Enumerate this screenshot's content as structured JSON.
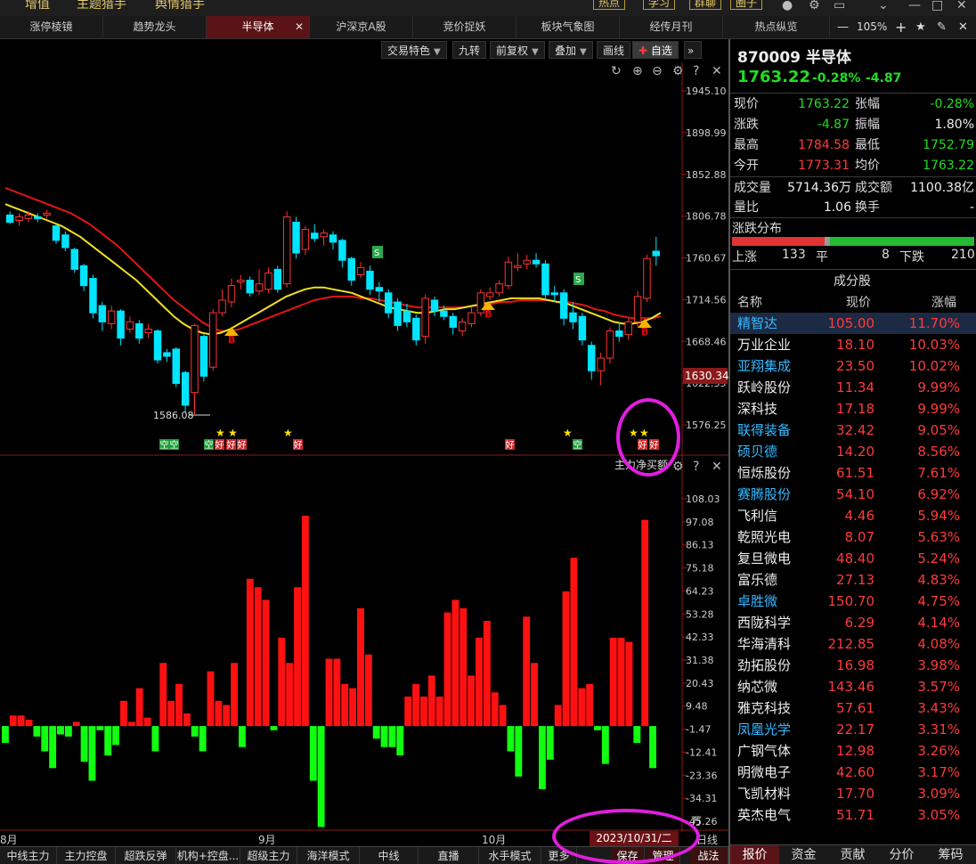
{
  "top_nav": {
    "items": [
      "增值",
      "主题猎手",
      "舆情猎手"
    ],
    "tools": [
      "热点",
      "学习",
      "群聊",
      "圈子"
    ]
  },
  "tabs": [
    "涨停棱镜",
    "趋势龙头",
    "半导体",
    "沪深京A股",
    "竞价捉妖",
    "板块气象图",
    "经传月刊",
    "热点纵览"
  ],
  "active_tab": "半导体",
  "zoom": "105%",
  "chart_toolbar": {
    "buttons": [
      "交易特色",
      "九转",
      "前复权",
      "叠加",
      "画线"
    ],
    "add_fav": "自选"
  },
  "chart": {
    "price_ticks": [
      "1945.10",
      "1898.99",
      "1852.88",
      "1806.78",
      "1760.67",
      "1714.56",
      "1668.46",
      "1622.35",
      "1576.25"
    ],
    "current_price_label": "1630.34",
    "low_label": "1586.08",
    "indicator_name": "主力净买额",
    "indicator_ticks": [
      "108.03",
      "97.08",
      "86.13",
      "75.18",
      "64.23",
      "53.28",
      "42.33",
      "31.38",
      "20.43",
      "9.48",
      "-1.47",
      "-12.41",
      "-23.36",
      "-34.31",
      "-45.26"
    ],
    "indicator_unit": "万",
    "months": [
      "8月",
      "9月",
      "10月"
    ],
    "date_cursor": "2023/10/31/二",
    "period_label": "日线",
    "signal_labels": {
      "kong": "空",
      "hao": "好",
      "buy": "B",
      "sell": "S"
    }
  },
  "bottom_tabs": [
    "中线主力",
    "主力控盘",
    "超跌反弹",
    "机构+控盘...",
    "超级主力",
    "海洋模式",
    "中线",
    "直播",
    "水手模式",
    "更多",
    "保存",
    "管理",
    "战法"
  ],
  "quote": {
    "code_name": "870009 半导体",
    "price": "1763.22",
    "pct": "-0.28%",
    "change": "-4.87",
    "rows": [
      {
        "l1": "现价",
        "v1": "1763.22",
        "c1": "green",
        "l2": "张幅",
        "v2": "-0.28%",
        "c2": "green"
      },
      {
        "l1": "涨跌",
        "v1": "-4.87",
        "c1": "green",
        "l2": "振幅",
        "v2": "1.80%",
        "c2": "white"
      },
      {
        "l1": "最高",
        "v1": "1784.58",
        "c1": "red",
        "l2": "最低",
        "v2": "1752.79",
        "c2": "green"
      },
      {
        "l1": "今开",
        "v1": "1773.31",
        "c1": "red",
        "l2": "均价",
        "v2": "1763.22",
        "c2": "green"
      }
    ],
    "rows2": [
      {
        "l1": "成交量",
        "v1": "5714.36万",
        "l2": "成交额",
        "v2": "1100.38亿"
      },
      {
        "l1": "量比",
        "v1": "1.06",
        "l2": "换手",
        "v2": "-"
      }
    ]
  },
  "distribution": {
    "title": "涨跌分布",
    "up_label": "上涨",
    "up": "133",
    "flat_label": "平",
    "flat": "8",
    "down_label": "下跌",
    "down": "210"
  },
  "components": {
    "title": "成分股",
    "headers": [
      "名称",
      "现价",
      "涨幅"
    ],
    "rows": [
      {
        "name": "精智达",
        "price": "105.00",
        "pct": "11.70%",
        "color": "cyan"
      },
      {
        "name": "万业企业",
        "price": "18.10",
        "pct": "10.03%",
        "color": "yel"
      },
      {
        "name": "亚翔集成",
        "price": "23.50",
        "pct": "10.02%",
        "color": "cyan"
      },
      {
        "name": "跃岭股份",
        "price": "11.34",
        "pct": "9.99%",
        "color": "yel"
      },
      {
        "name": "深科技",
        "price": "17.18",
        "pct": "9.99%",
        "color": "yel"
      },
      {
        "name": "联得装备",
        "price": "32.42",
        "pct": "9.05%",
        "color": "cyan"
      },
      {
        "name": "硕贝德",
        "price": "14.20",
        "pct": "8.56%",
        "color": "cyan"
      },
      {
        "name": "恒烁股份",
        "price": "61.51",
        "pct": "7.61%",
        "color": "yel"
      },
      {
        "name": "赛腾股份",
        "price": "54.10",
        "pct": "6.92%",
        "color": "cyan"
      },
      {
        "name": "飞利信",
        "price": "4.46",
        "pct": "5.94%",
        "color": "yel"
      },
      {
        "name": "乾照光电",
        "price": "8.07",
        "pct": "5.63%",
        "color": "yel"
      },
      {
        "name": "复旦微电",
        "price": "48.40",
        "pct": "5.24%",
        "color": "yel"
      },
      {
        "name": "富乐德",
        "price": "27.13",
        "pct": "4.83%",
        "color": "yel"
      },
      {
        "name": "卓胜微",
        "price": "150.70",
        "pct": "4.75%",
        "color": "cyan"
      },
      {
        "name": "西陇科学",
        "price": "6.29",
        "pct": "4.14%",
        "color": "yel"
      },
      {
        "name": "华海清科",
        "price": "212.85",
        "pct": "4.08%",
        "color": "yel"
      },
      {
        "name": "劲拓股份",
        "price": "16.98",
        "pct": "3.98%",
        "color": "yel"
      },
      {
        "name": "纳芯微",
        "price": "143.46",
        "pct": "3.57%",
        "color": "yel"
      },
      {
        "name": "雅克科技",
        "price": "57.61",
        "pct": "3.43%",
        "color": "yel"
      },
      {
        "name": "凤凰光学",
        "price": "22.17",
        "pct": "3.31%",
        "color": "cyan"
      },
      {
        "name": "广钢气体",
        "price": "12.98",
        "pct": "3.26%",
        "color": "yel"
      },
      {
        "name": "明微电子",
        "price": "42.60",
        "pct": "3.17%",
        "color": "yel"
      },
      {
        "name": "飞凯材料",
        "price": "17.70",
        "pct": "3.09%",
        "color": "yel"
      },
      {
        "name": "英杰电气",
        "price": "51.71",
        "pct": "3.05%",
        "color": "yel"
      }
    ]
  },
  "right_tabs": [
    "报价",
    "资金",
    "贡献",
    "分价",
    "筹码"
  ],
  "right_tab_active": "报价",
  "chart_data": {
    "type": "candlestick",
    "title": "",
    "price_axis": [
      1576.25,
      1945.1
    ],
    "candles": [
      [
        1808,
        1800,
        1812,
        1798
      ],
      [
        1802,
        1806,
        1810,
        1796
      ],
      [
        1804,
        1808,
        1812,
        1800
      ],
      [
        1806,
        1804,
        1810,
        1800
      ],
      [
        1808,
        1810,
        1814,
        1804
      ],
      [
        1796,
        1780,
        1798,
        1776
      ],
      [
        1786,
        1772,
        1790,
        1768
      ],
      [
        1770,
        1748,
        1772,
        1744
      ],
      [
        1752,
        1730,
        1754,
        1724
      ],
      [
        1738,
        1700,
        1742,
        1694
      ],
      [
        1708,
        1690,
        1712,
        1680
      ],
      [
        1688,
        1702,
        1708,
        1682
      ],
      [
        1702,
        1672,
        1704,
        1664
      ],
      [
        1682,
        1690,
        1696,
        1678
      ],
      [
        1688,
        1672,
        1692,
        1666
      ],
      [
        1678,
        1682,
        1688,
        1672
      ],
      [
        1680,
        1648,
        1682,
        1644
      ],
      [
        1656,
        1652,
        1660,
        1646
      ],
      [
        1660,
        1622,
        1662,
        1618
      ],
      [
        1634,
        1598,
        1636,
        1590
      ],
      [
        1612,
        1686,
        1688,
        1588
      ],
      [
        1674,
        1630,
        1676,
        1624
      ],
      [
        1640,
        1700,
        1704,
        1636
      ],
      [
        1700,
        1714,
        1726,
        1696
      ],
      [
        1712,
        1730,
        1738,
        1706
      ],
      [
        1734,
        1736,
        1742,
        1726
      ],
      [
        1736,
        1722,
        1740,
        1718
      ],
      [
        1724,
        1732,
        1748,
        1720
      ],
      [
        1726,
        1744,
        1750,
        1722
      ],
      [
        1748,
        1726,
        1752,
        1722
      ],
      [
        1732,
        1806,
        1812,
        1728
      ],
      [
        1800,
        1766,
        1806,
        1760
      ],
      [
        1770,
        1792,
        1796,
        1764
      ],
      [
        1788,
        1782,
        1798,
        1778
      ],
      [
        1784,
        1788,
        1792,
        1774
      ],
      [
        1786,
        1778,
        1790,
        1770
      ],
      [
        1780,
        1758,
        1782,
        1750
      ],
      [
        1760,
        1736,
        1762,
        1730
      ],
      [
        1742,
        1750,
        1756,
        1738
      ],
      [
        1746,
        1726,
        1752,
        1720
      ],
      [
        1728,
        1724,
        1734,
        1712
      ],
      [
        1722,
        1700,
        1726,
        1694
      ],
      [
        1712,
        1686,
        1716,
        1680
      ],
      [
        1702,
        1690,
        1710,
        1684
      ],
      [
        1694,
        1670,
        1698,
        1664
      ],
      [
        1674,
        1716,
        1720,
        1666
      ],
      [
        1714,
        1702,
        1718,
        1696
      ],
      [
        1702,
        1696,
        1708,
        1692
      ],
      [
        1696,
        1684,
        1700,
        1676
      ],
      [
        1680,
        1690,
        1694,
        1674
      ],
      [
        1688,
        1700,
        1706,
        1684
      ],
      [
        1700,
        1722,
        1726,
        1696
      ],
      [
        1718,
        1722,
        1728,
        1714
      ],
      [
        1722,
        1732,
        1736,
        1718
      ],
      [
        1730,
        1756,
        1762,
        1726
      ],
      [
        1750,
        1752,
        1766,
        1746
      ],
      [
        1754,
        1758,
        1764,
        1748
      ],
      [
        1758,
        1754,
        1766,
        1750
      ],
      [
        1754,
        1720,
        1758,
        1714
      ],
      [
        1722,
        1720,
        1730,
        1712
      ],
      [
        1722,
        1694,
        1726,
        1686
      ],
      [
        1700,
        1690,
        1712,
        1682
      ],
      [
        1696,
        1670,
        1700,
        1664
      ],
      [
        1664,
        1636,
        1668,
        1626
      ],
      [
        1636,
        1650,
        1656,
        1620
      ],
      [
        1650,
        1680,
        1684,
        1644
      ],
      [
        1680,
        1674,
        1690,
        1668
      ],
      [
        1676,
        1690,
        1694,
        1670
      ],
      [
        1690,
        1718,
        1724,
        1684
      ],
      [
        1716,
        1760,
        1764,
        1712
      ],
      [
        1768,
        1763,
        1784,
        1752
      ]
    ],
    "ma_yellow": [
      1820,
      1816,
      1812,
      1808,
      1804,
      1800,
      1796,
      1790,
      1784,
      1776,
      1768,
      1760,
      1752,
      1744,
      1736,
      1726,
      1716,
      1706,
      1696,
      1688,
      1682,
      1678,
      1676,
      1678,
      1682,
      1688,
      1694,
      1700,
      1706,
      1712,
      1718,
      1722,
      1726,
      1728,
      1728,
      1726,
      1724,
      1722,
      1718,
      1714,
      1710,
      1706,
      1704,
      1702,
      1700,
      1700,
      1702,
      1704,
      1704,
      1706,
      1708,
      1710,
      1712,
      1714,
      1716,
      1716,
      1716,
      1716,
      1714,
      1712,
      1710,
      1706,
      1702,
      1698,
      1694,
      1690,
      1688,
      1688,
      1690,
      1694,
      1700
    ],
    "ma_red": [
      1838,
      1834,
      1830,
      1826,
      1822,
      1818,
      1814,
      1810,
      1804,
      1798,
      1790,
      1782,
      1774,
      1764,
      1754,
      1744,
      1734,
      1724,
      1714,
      1706,
      1698,
      1690,
      1684,
      1680,
      1680,
      1682,
      1686,
      1690,
      1694,
      1698,
      1702,
      1706,
      1710,
      1714,
      1716,
      1718,
      1718,
      1718,
      1716,
      1716,
      1714,
      1712,
      1710,
      1708,
      1706,
      1706,
      1706,
      1706,
      1706,
      1706,
      1708,
      1708,
      1710,
      1712,
      1712,
      1714,
      1714,
      1714,
      1714,
      1712,
      1712,
      1710,
      1708,
      1704,
      1702,
      1698,
      1696,
      1694,
      1694,
      1694,
      1696
    ],
    "indicator_axis": [
      -45.26,
      108.03
    ],
    "net_buy": [
      -8,
      5,
      5,
      3,
      -5,
      -12,
      -20,
      -4,
      -5,
      2,
      -17,
      -26,
      -2,
      -14,
      -9,
      12,
      2,
      18,
      4,
      -12,
      30,
      12,
      20,
      6,
      -5,
      -12,
      26,
      12,
      10,
      30,
      -10,
      70,
      66,
      60,
      -2,
      42,
      30,
      66,
      100,
      -26,
      -48,
      32,
      32,
      20,
      18,
      56,
      34,
      -6,
      -10,
      -10,
      -14,
      14,
      20,
      14,
      24,
      14,
      54,
      60,
      56,
      24,
      42,
      50,
      16,
      10,
      -12,
      -24,
      52,
      30,
      -30,
      -16,
      10,
      64,
      80,
      18,
      20,
      -2,
      -18,
      42,
      42,
      40,
      -8,
      98,
      -20
    ]
  }
}
